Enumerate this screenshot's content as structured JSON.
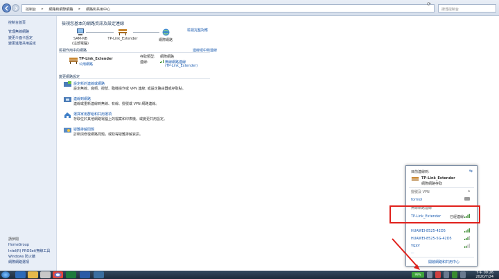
{
  "address": {
    "crumbs": [
      "控制台",
      "網路和網際網路",
      "網路和共用中心"
    ],
    "search_placeholder": "搜尋控制台"
  },
  "sidebar": {
    "home": "控制台首頁",
    "links": [
      "管理無線網路",
      "變更介面卡設定",
      "變更進階共用設定"
    ],
    "see_also_header": "請參閱",
    "see_also": [
      "HomeGroup",
      "Intel(R) PROSet/無線工具",
      "Windows 防火牆",
      "網際網路選項"
    ]
  },
  "main": {
    "title": "檢視您基本的網路資訊及設定連線",
    "view_full_map": "檢視完整對應",
    "node_computer_line1": "SAM-NB",
    "node_computer_line2": "(這部電腦)",
    "node_network": "TP-Link_Extender",
    "node_internet": "網際網路",
    "active_networks_header": "檢視作用中的網路",
    "connect_disconnect": "連線或中斷連線",
    "network_name": "TP-Link_Extender",
    "network_type": "公用網路",
    "access_type_label": "存取類型:",
    "access_type_value": "網際網路",
    "connections_label": "連線:",
    "connection_value": "無線網路連線",
    "connection_sub": "(TP-Link_Extender)",
    "change_settings_header": "變更網路設定",
    "tasks": [
      {
        "link": "設定新的連線或網路",
        "desc": "設定無線、寬頻、撥號、臨機操作或 VPN 連線; 或設定路由器或存取點。"
      },
      {
        "link": "連線到網路",
        "desc": "連線或重新連線到無線、有線、撥號或 VPN 網路連線。"
      },
      {
        "link": "選擇家用群組和共用選項",
        "desc": "存取位於其他網路電腦上的檔案和印表機，或變更共用設定。"
      },
      {
        "link": "疑難排解問題",
        "desc": "診斷與修復網路問題，或取得疑難排解資訊。"
      }
    ]
  },
  "popup": {
    "header": "目前連線到:",
    "current_name": "TP-Link_Extender",
    "current_sub": "網際網路存取",
    "vpn_header": "撥號及 VPN",
    "vpn_item": "formol",
    "wireless_header": "無線網路連線",
    "selected_network": "TP-Link_Extender",
    "selected_status": "已經連線",
    "others": [
      "HUAWEI-8525-42D5",
      "HUAWEI-8525-5G-42D5",
      "YSXY",
      "..."
    ],
    "footer_link": "開啟網路和共用中心"
  },
  "taskbar": {
    "battery": "99%",
    "time": "下午 09:26",
    "date": "2020/7/24"
  }
}
